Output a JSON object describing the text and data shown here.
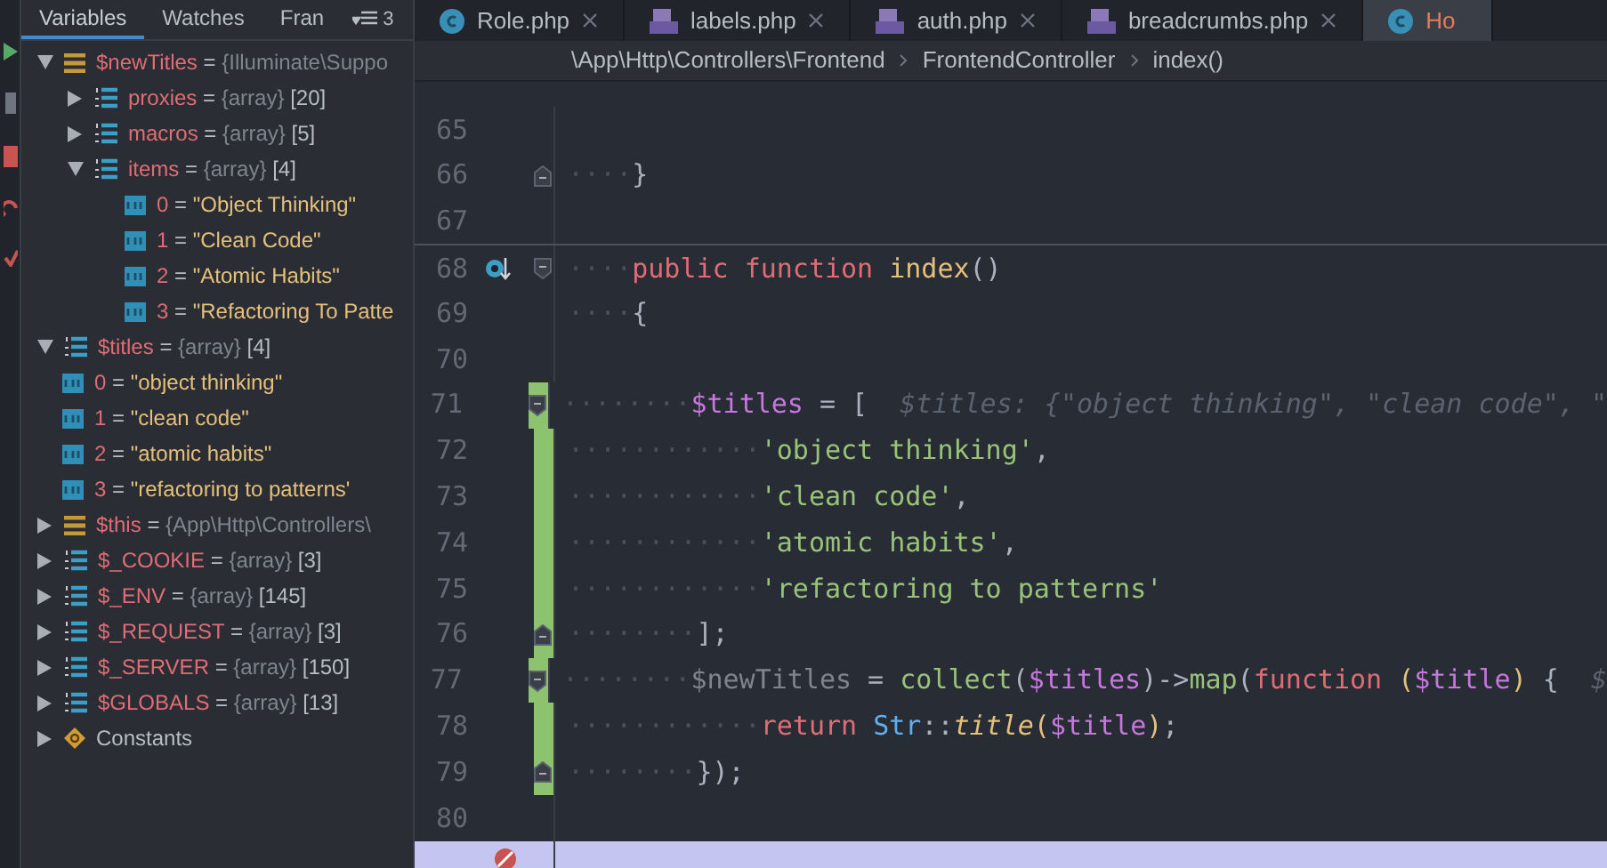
{
  "debugger": {
    "tabs": [
      {
        "label": "Variables",
        "selected": true
      },
      {
        "label": "Watches",
        "selected": false
      },
      {
        "label": "Fran",
        "selected": false
      }
    ],
    "more_count": "3",
    "variables": [
      {
        "kind": "object",
        "name": "$newTitles",
        "value": "= {Illuminate\\Suppo",
        "expanded": true,
        "children": [
          {
            "kind": "array",
            "name": "proxies",
            "type": "= {array}",
            "count": "[20]",
            "expanded": false
          },
          {
            "kind": "array",
            "name": "macros",
            "type": "= {array}",
            "count": "[5]",
            "expanded": false
          },
          {
            "kind": "array",
            "name": "items",
            "type": "= {array}",
            "count": "[4]",
            "expanded": true,
            "children": [
              {
                "kind": "string",
                "name": "0",
                "value": "= \"Object Thinking\""
              },
              {
                "kind": "string",
                "name": "1",
                "value": "= \"Clean Code\""
              },
              {
                "kind": "string",
                "name": "2",
                "value": "= \"Atomic Habits\""
              },
              {
                "kind": "string",
                "name": "3",
                "value": "= \"Refactoring To Patte"
              }
            ]
          }
        ]
      },
      {
        "kind": "array",
        "name": "$titles",
        "type": "= {array}",
        "count": "[4]",
        "expanded": true,
        "children": [
          {
            "kind": "string",
            "name": "0",
            "value": "= \"object thinking\""
          },
          {
            "kind": "string",
            "name": "1",
            "value": "= \"clean code\""
          },
          {
            "kind": "string",
            "name": "2",
            "value": "= \"atomic habits\""
          },
          {
            "kind": "string",
            "name": "3",
            "value": "= \"refactoring to patterns'"
          }
        ]
      },
      {
        "kind": "object",
        "name": "$this",
        "value": "= {App\\Http\\Controllers\\",
        "expanded": false
      },
      {
        "kind": "array",
        "name": "$_COOKIE",
        "type": "= {array}",
        "count": "[3]",
        "expanded": false
      },
      {
        "kind": "array",
        "name": "$_ENV",
        "type": "= {array}",
        "count": "[145]",
        "expanded": false
      },
      {
        "kind": "array",
        "name": "$_REQUEST",
        "type": "= {array}",
        "count": "[3]",
        "expanded": false
      },
      {
        "kind": "array",
        "name": "$_SERVER",
        "type": "= {array}",
        "count": "[150]",
        "expanded": false
      },
      {
        "kind": "array",
        "name": "$GLOBALS",
        "type": "= {array}",
        "count": "[13]",
        "expanded": false
      },
      {
        "kind": "constant",
        "name": "Constants",
        "expanded": false
      }
    ]
  },
  "editor": {
    "tabs": [
      {
        "label": "Role.php",
        "kind": "class",
        "selected": false
      },
      {
        "label": "labels.php",
        "kind": "php",
        "selected": false
      },
      {
        "label": "auth.php",
        "kind": "php",
        "selected": false
      },
      {
        "label": "breadcrumbs.php",
        "kind": "php",
        "selected": false
      },
      {
        "label": "Ho",
        "kind": "class",
        "selected": true
      }
    ],
    "breadcrumbs": [
      "\\App\\Http\\Controllers\\Frontend",
      "FrontendController",
      "index()"
    ],
    "lines": [
      {
        "number": "65"
      },
      {
        "number": "66",
        "fold_end": true,
        "tokens": [
          {
            "kind": "indent",
            "text": "····"
          },
          {
            "kind": "punct",
            "text": "}"
          }
        ]
      },
      {
        "number": "67"
      },
      {
        "number": "68",
        "fold_start": true,
        "separator": true,
        "marker": true,
        "tokens": [
          {
            "kind": "indent",
            "text": "····"
          },
          {
            "kind": "keyword",
            "text": "public function "
          },
          {
            "kind": "func",
            "text": "index"
          },
          {
            "kind": "punct",
            "text": "()"
          }
        ]
      },
      {
        "number": "69",
        "tokens": [
          {
            "kind": "indent",
            "text": "····"
          },
          {
            "kind": "punct",
            "text": "{"
          }
        ]
      },
      {
        "number": "70"
      },
      {
        "number": "71",
        "changed": true,
        "fold_start": true,
        "tokens": [
          {
            "kind": "indent",
            "text": "········"
          },
          {
            "kind": "variable",
            "text": "$titles"
          },
          {
            "kind": "punct",
            "text": " = [  "
          },
          {
            "kind": "hint",
            "text": "$titles: {\"object thinking\", \"clean code\", \""
          }
        ]
      },
      {
        "number": "72",
        "changed": true,
        "tokens": [
          {
            "kind": "indent",
            "text": "············"
          },
          {
            "kind": "string",
            "text": "'object thinking'"
          },
          {
            "kind": "punct",
            "text": ","
          }
        ]
      },
      {
        "number": "73",
        "changed": true,
        "tokens": [
          {
            "kind": "indent",
            "text": "············"
          },
          {
            "kind": "string",
            "text": "'clean code'"
          },
          {
            "kind": "punct",
            "text": ","
          }
        ]
      },
      {
        "number": "74",
        "changed": true,
        "tokens": [
          {
            "kind": "indent",
            "text": "············"
          },
          {
            "kind": "string",
            "text": "'atomic habits'"
          },
          {
            "kind": "punct",
            "text": ","
          }
        ]
      },
      {
        "number": "75",
        "changed": true,
        "tokens": [
          {
            "kind": "indent",
            "text": "············"
          },
          {
            "kind": "string",
            "text": "'refactoring to patterns'"
          }
        ]
      },
      {
        "number": "76",
        "changed": true,
        "fold_end": true,
        "tokens": [
          {
            "kind": "indent",
            "text": "········"
          },
          {
            "kind": "punct",
            "text": "];"
          }
        ]
      },
      {
        "number": "77",
        "changed": true,
        "fold_start": true,
        "tokens": [
          {
            "kind": "indent",
            "text": "········"
          },
          {
            "kind": "unused",
            "text": "$newTitles"
          },
          {
            "kind": "punct",
            "text": " = "
          },
          {
            "kind": "call",
            "text": "collect"
          },
          {
            "kind": "punct",
            "text": "("
          },
          {
            "kind": "variable",
            "text": "$titles"
          },
          {
            "kind": "punct",
            "text": ")->"
          },
          {
            "kind": "call",
            "text": "map"
          },
          {
            "kind": "punct",
            "text": "("
          },
          {
            "kind": "keyword",
            "text": "function "
          },
          {
            "kind": "paren",
            "text": "("
          },
          {
            "kind": "variable",
            "text": "$title"
          },
          {
            "kind": "paren",
            "text": ")"
          },
          {
            "kind": "punct",
            "text": " {  "
          },
          {
            "kind": "hint",
            "text": "$"
          }
        ]
      },
      {
        "number": "78",
        "changed": true,
        "tokens": [
          {
            "kind": "indent",
            "text": "············"
          },
          {
            "kind": "keyword",
            "text": "return "
          },
          {
            "kind": "class",
            "text": "Str"
          },
          {
            "kind": "punct",
            "text": "::"
          },
          {
            "kind": "method",
            "text": "title"
          },
          {
            "kind": "paren",
            "text": "("
          },
          {
            "kind": "variable",
            "text": "$title"
          },
          {
            "kind": "paren",
            "text": ")"
          },
          {
            "kind": "punct",
            "text": ";"
          }
        ]
      },
      {
        "number": "79",
        "changed": true,
        "fold_end": true,
        "tokens": [
          {
            "kind": "indent",
            "text": "········"
          },
          {
            "kind": "punct",
            "text": "});"
          }
        ]
      },
      {
        "number": "80"
      },
      {
        "highlighted": true,
        "breakpoint": true
      }
    ]
  }
}
